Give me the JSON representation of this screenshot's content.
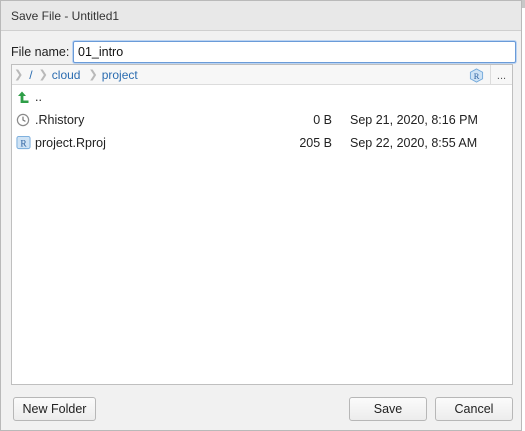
{
  "window": {
    "title": "Save File - Untitled1"
  },
  "filename": {
    "label": "File name:",
    "value": "01_intro"
  },
  "breadcrumb": {
    "items": [
      {
        "label": "/"
      },
      {
        "label": "cloud"
      },
      {
        "label": "project"
      }
    ],
    "more_label": "..."
  },
  "files": [
    {
      "icon": "up-arrow-icon",
      "name": "..",
      "size": "",
      "modified": ""
    },
    {
      "icon": "history-file-icon",
      "name": ".Rhistory",
      "size": "0 B",
      "modified": "Sep 21, 2020, 8:16 PM"
    },
    {
      "icon": "rproj-icon",
      "name": "project.Rproj",
      "size": "205 B",
      "modified": "Sep 22, 2020, 8:55 AM"
    }
  ],
  "buttons": {
    "new_folder": "New Folder",
    "save": "Save",
    "cancel": "Cancel"
  },
  "colors": {
    "accent_link": "#2b6cb0",
    "up_arrow": "#2e9e47",
    "rproj_blue": "#75aadb"
  }
}
